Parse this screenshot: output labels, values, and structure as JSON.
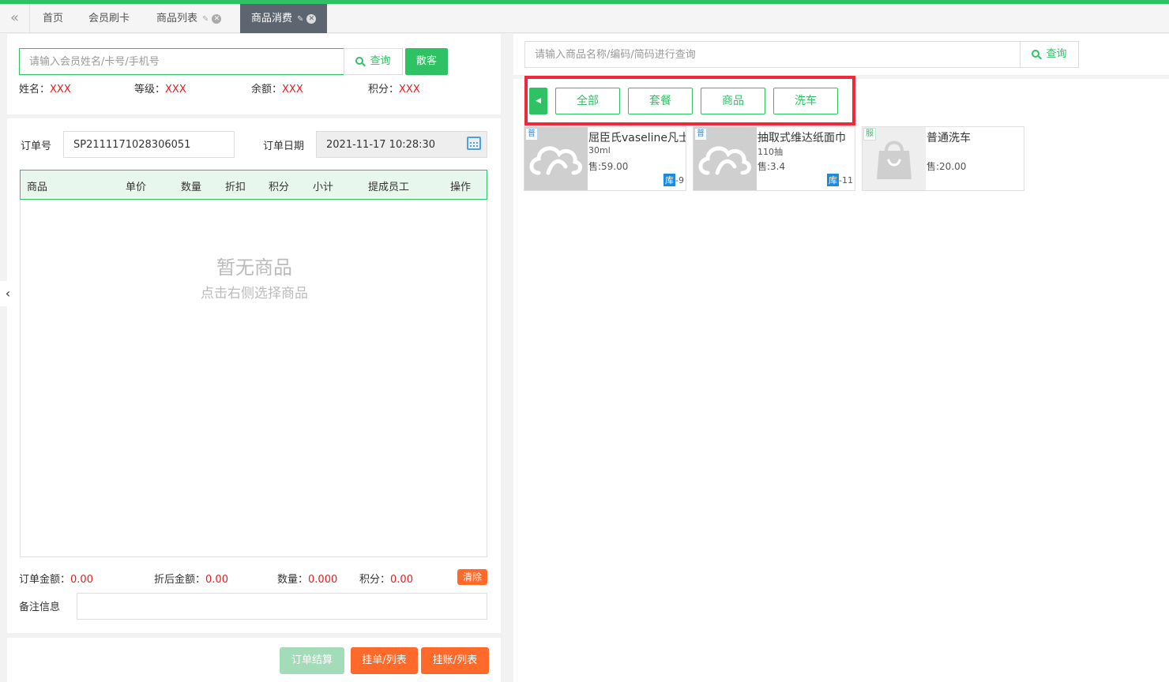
{
  "tabs": {
    "items": [
      {
        "label": "首页"
      },
      {
        "label": "会员刷卡"
      },
      {
        "label": "商品列表"
      },
      {
        "label": "商品消费"
      }
    ]
  },
  "member": {
    "search_placeholder": "请输入会员姓名/卡号/手机号",
    "search_label": "查询",
    "guest_label": "散客",
    "name_label": "姓名：",
    "name_value": "XXX",
    "level_label": "等级：",
    "level_value": "XXX",
    "balance_label": "余额：",
    "balance_value": "XXX",
    "points_label": "积分：",
    "points_value": "XXX"
  },
  "order": {
    "number_label": "订单号",
    "number_value": "SP2111171028306051",
    "date_label": "订单日期",
    "date_value": "2021-11-17 10:28:30",
    "columns": [
      "商品",
      "单价",
      "数量",
      "折扣",
      "积分",
      "小计",
      "提成员工",
      "操作"
    ],
    "empty_title": "暂无商品",
    "empty_subtitle": "点击右侧选择商品"
  },
  "summary": {
    "order_amount_label": "订单金额：",
    "order_amount_value": "0.00",
    "discount_amount_label": "折后金额：",
    "discount_amount_value": "0.00",
    "qty_label": "数量：",
    "qty_value": "0.000",
    "points_label": "积分：",
    "points_value": "0.00",
    "clear_label": "清除",
    "remark_label": "备注信息",
    "remark_value": ""
  },
  "actions": {
    "checkout_label": "订单结算",
    "hang_order_label": "挂单/列表",
    "hang_account_label": "挂账/列表"
  },
  "product_search": {
    "placeholder": "请输入商品名称/编码/简码进行查询",
    "search_label": "查询"
  },
  "categories": [
    {
      "label": "全部"
    },
    {
      "label": "套餐"
    },
    {
      "label": "商品"
    },
    {
      "label": "洗车"
    }
  ],
  "products": [
    {
      "badge": "普",
      "name": "屈臣氏vaseline凡士林",
      "spec": "30ml",
      "price": "售:59.00",
      "stock_label": "库",
      "stock_value": "-9"
    },
    {
      "badge": "普",
      "name": "抽取式维达纸面巾",
      "spec": "110抽",
      "price": "售:3.4",
      "stock_label": "库",
      "stock_value": "-11"
    },
    {
      "badge": "服",
      "name": "普通洗车",
      "spec": "",
      "price": "售:20.00",
      "stock_label": "",
      "stock_value": ""
    }
  ],
  "colors": {
    "accent": "#2ec264",
    "danger": "#e02020",
    "warning": "#ff6a2a",
    "highlight": "#ee2a3a"
  }
}
